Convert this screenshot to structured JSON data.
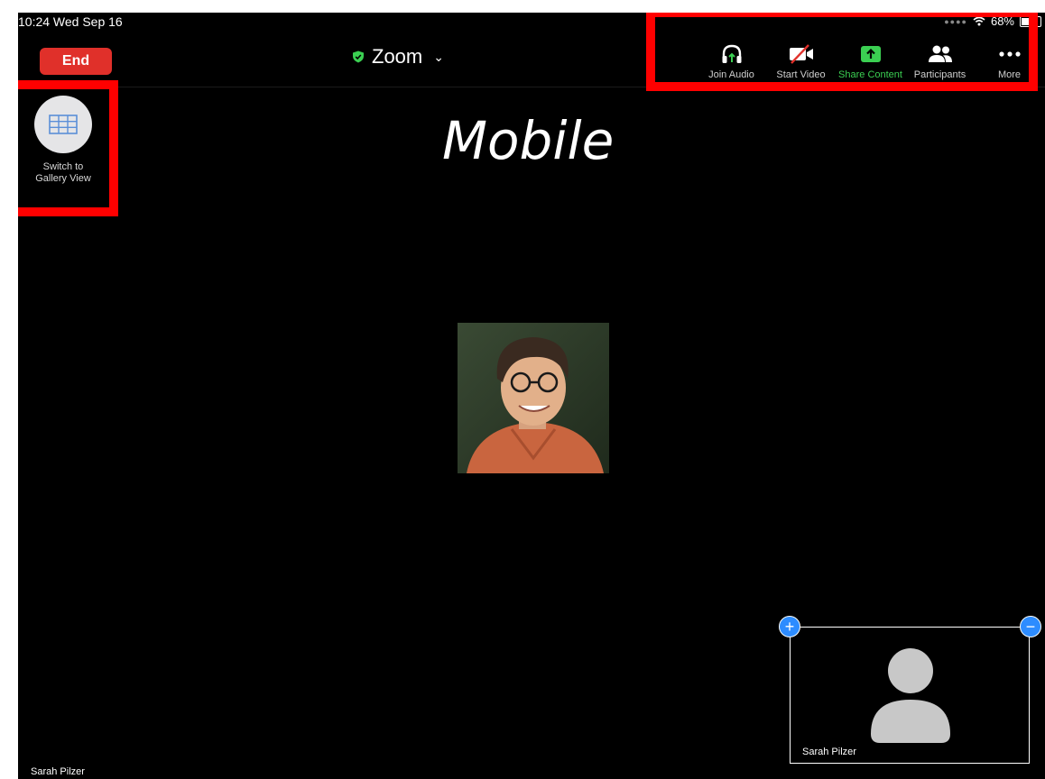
{
  "status": {
    "time": "10:24  Wed Sep 16",
    "battery": "68%",
    "battery_fraction": 0.68
  },
  "header": {
    "end_label": "End",
    "meeting_title": "Zoom",
    "title_chevron": "⌄"
  },
  "toolbar": {
    "items": [
      {
        "label": "Join Audio",
        "icon": "headphones-icon"
      },
      {
        "label": "Start Video",
        "icon": "video-off-icon"
      },
      {
        "label": "Share Content",
        "icon": "share-screen-icon",
        "color": "#3bcf52"
      },
      {
        "label": "Participants",
        "icon": "participants-icon"
      },
      {
        "label": "More",
        "icon": "more-dots-icon"
      }
    ]
  },
  "gallery": {
    "label": "Switch to Gallery View",
    "icon": "grid-icon"
  },
  "content": {
    "shared_text": "Mobile",
    "speaker_name": "Sarah Pilzer"
  },
  "self_view": {
    "name": "Sarah Pilzer",
    "expand_symbol": "+",
    "collapse_symbol": "−"
  },
  "colors": {
    "end_red": "#e0302a",
    "share_green": "#3bcf52",
    "accent_blue": "#2d8cff",
    "highlight_red": "#ff0000"
  }
}
